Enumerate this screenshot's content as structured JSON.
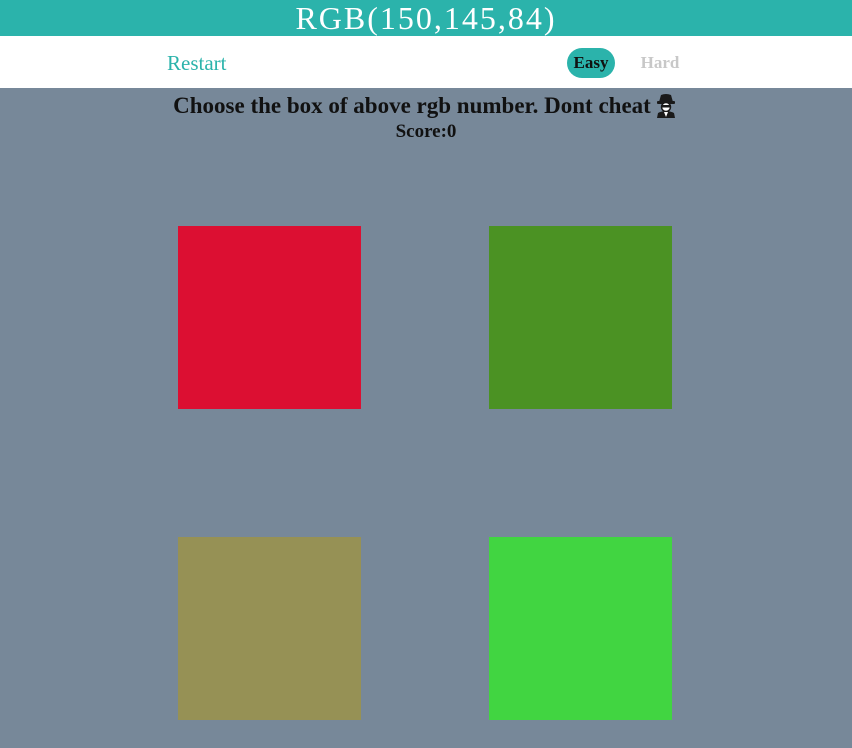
{
  "header": {
    "title": "RGB(150,145,84)"
  },
  "nav": {
    "restart_label": "Restart",
    "easy_label": "Easy",
    "hard_label": "Hard",
    "active_mode": "Easy"
  },
  "message": {
    "text": "Choose the box of above rgb number. Dont cheat",
    "icon": "detective-icon"
  },
  "score": {
    "label": "Score:",
    "value": "0"
  },
  "boxes": [
    {
      "color": "#dc0f32"
    },
    {
      "color": "#4b9223"
    },
    {
      "color": "#969155"
    },
    {
      "color": "#41d541"
    }
  ],
  "colors": {
    "accent": "#2bb3ab",
    "background": "#778899",
    "inactive_mode_text": "#c8c8c8"
  }
}
